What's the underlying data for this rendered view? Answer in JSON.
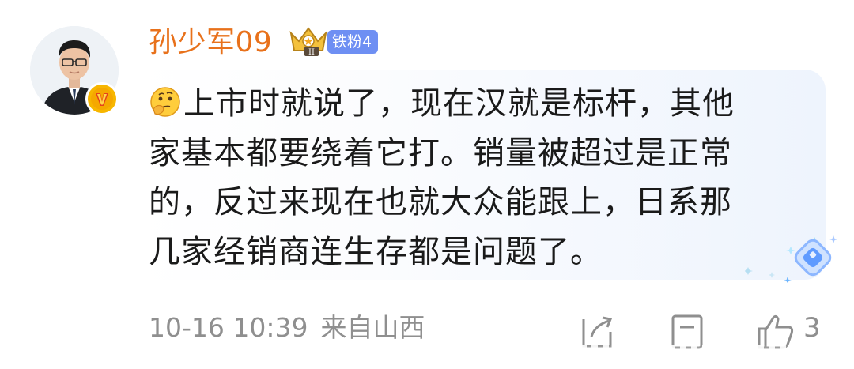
{
  "user": {
    "name": "孙少军09",
    "fan_badge": "铁粉4",
    "avatar_icon": "verified-user-avatar",
    "crown_icon": "crown-level-icon",
    "crown_level": "II"
  },
  "comment": {
    "emoji": "thinking-face-emoji",
    "lines": [
      "上市时就说了，现在汉就是标杆，其他",
      "家基本都要绕着它打。销量被超过是正常",
      "的，反过来现在也就大众能跟上，日系那",
      "几家经销商连生存都是问题了。"
    ]
  },
  "footer": {
    "timestamp": "10-16 10:39",
    "source": "来自山西",
    "like_count": "3"
  },
  "colors": {
    "username": "#e8711b",
    "fan_badge_bg": "#6e8ff3",
    "meta_text": "#8f8f8f",
    "verified_badge": "#f7b600"
  }
}
